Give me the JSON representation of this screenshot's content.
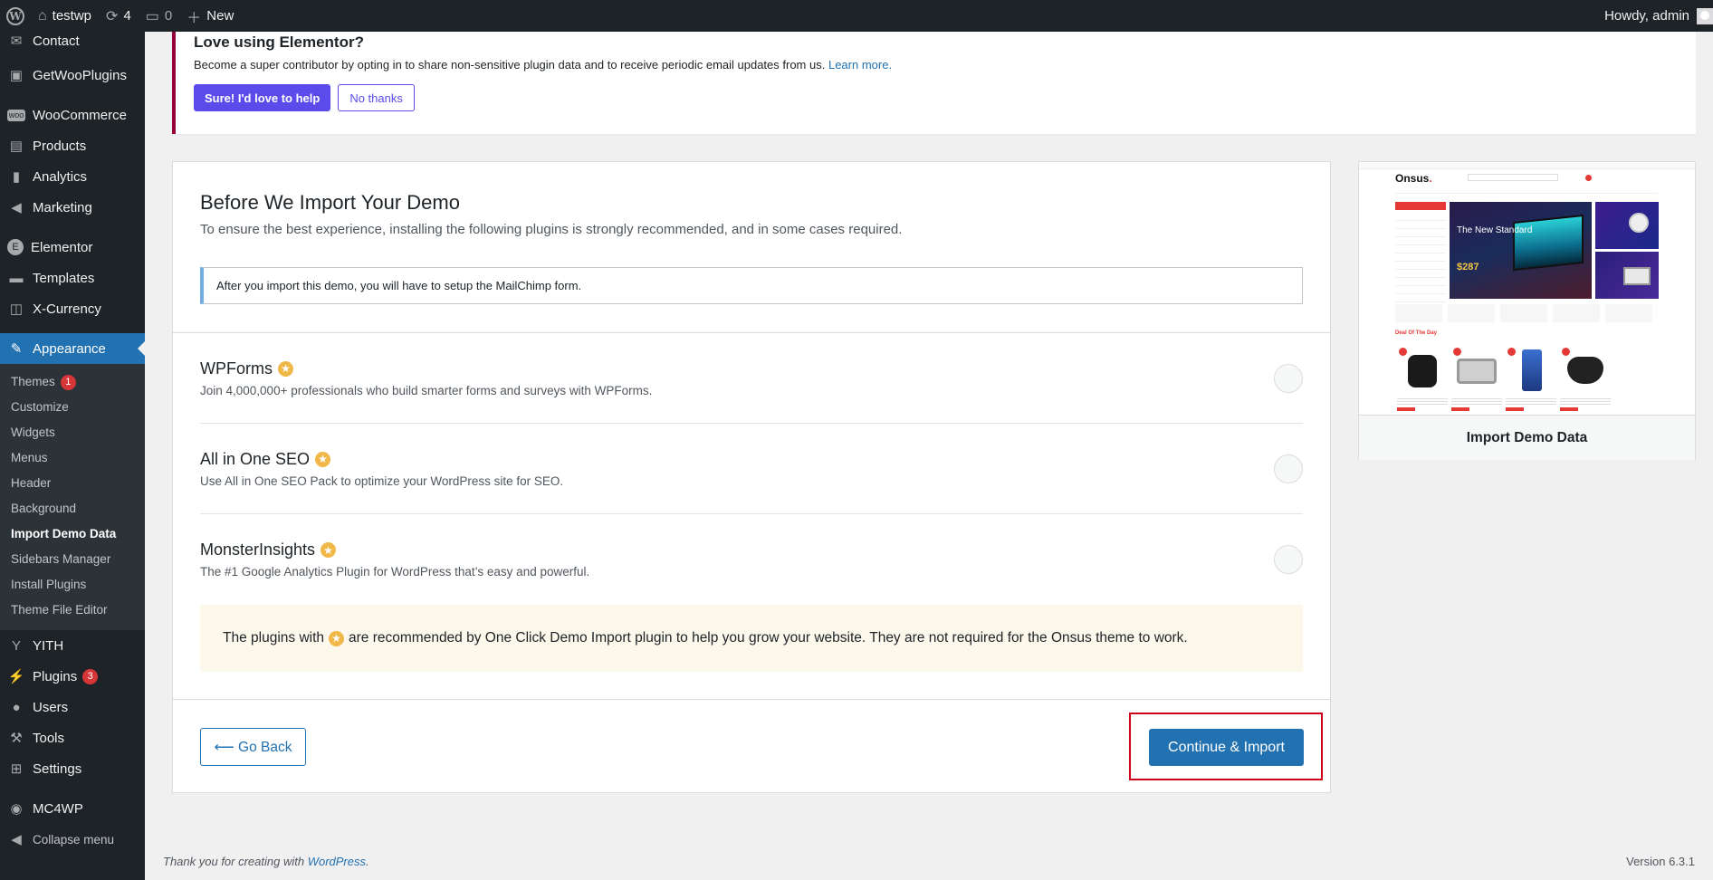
{
  "adminbar": {
    "site_name": "testwp",
    "updates_count": "4",
    "comments_count": "0",
    "new_label": "New",
    "howdy": "Howdy, admin"
  },
  "sidebar": {
    "items_top": [
      {
        "label": "Contact",
        "icon": "envelope-icon"
      },
      {
        "label": "GetWooPlugins",
        "icon": "plugin-box-icon"
      },
      {
        "label": "WooCommerce",
        "icon": "woo-icon"
      },
      {
        "label": "Products",
        "icon": "archive-icon"
      },
      {
        "label": "Analytics",
        "icon": "bar-chart-icon"
      },
      {
        "label": "Marketing",
        "icon": "megaphone-icon"
      },
      {
        "label": "Elementor",
        "icon": "elementor-icon"
      },
      {
        "label": "Templates",
        "icon": "folder-icon"
      },
      {
        "label": "X-Currency",
        "icon": "currency-icon"
      }
    ],
    "appearance": "Appearance",
    "appearance_sub": [
      {
        "label": "Themes",
        "badge": "1"
      },
      {
        "label": "Customize"
      },
      {
        "label": "Widgets"
      },
      {
        "label": "Menus"
      },
      {
        "label": "Header"
      },
      {
        "label": "Background"
      },
      {
        "label": "Import Demo Data"
      },
      {
        "label": "Sidebars Manager"
      },
      {
        "label": "Install Plugins"
      },
      {
        "label": "Theme File Editor"
      }
    ],
    "items_bottom": [
      {
        "label": "YITH",
        "icon": "yith-icon"
      },
      {
        "label": "Plugins",
        "icon": "plugins-icon",
        "badge": "3"
      },
      {
        "label": "Users",
        "icon": "users-icon"
      },
      {
        "label": "Tools",
        "icon": "wrench-icon"
      },
      {
        "label": "Settings",
        "icon": "settings-icon"
      },
      {
        "label": "MC4WP",
        "icon": "mc4wp-icon"
      },
      {
        "label": "Collapse menu",
        "icon": "collapse-icon"
      }
    ]
  },
  "notice": {
    "title": "Love using Elementor?",
    "text": "Become a super contributor by opting in to share non-sensitive plugin data and to receive periodic email updates from us.",
    "learn_more": "Learn more.",
    "accept": "Sure! I'd love to help",
    "decline": "No thanks"
  },
  "card": {
    "title": "Before We Import Your Demo",
    "subtitle": "To ensure the best experience, installing the following plugins is strongly recommended, and in some cases required.",
    "info": "After you import this demo, you will have to setup the MailChimp form.",
    "plugins": [
      {
        "name": "WPForms",
        "desc": "Join 4,000,000+ professionals who build smarter forms and surveys with WPForms."
      },
      {
        "name": "All in One SEO",
        "desc": "Use All in One SEO Pack to optimize your WordPress site for SEO."
      },
      {
        "name": "MonsterInsights",
        "desc": "The #1 Google Analytics Plugin for WordPress that’s easy and powerful."
      }
    ],
    "recommend_pre": "The plugins with",
    "recommend_post": "are recommended by One Click Demo Import plugin to help you grow your website. They are not required for the Onsus theme to work.",
    "back": "⟵ Go Back",
    "continue": "Continue & Import"
  },
  "preview": {
    "label": "Import Demo Data",
    "shot": {
      "logo": "Onsus",
      "logo_dot": ".",
      "hero_text": "The New Standard",
      "hero_price": "$287",
      "deal_title": "Deal Of The Day"
    }
  },
  "footer": {
    "thanks": "Thank you for creating with",
    "wp": "WordPress",
    "thanks_end": ".",
    "version": "Version 6.3.1"
  }
}
